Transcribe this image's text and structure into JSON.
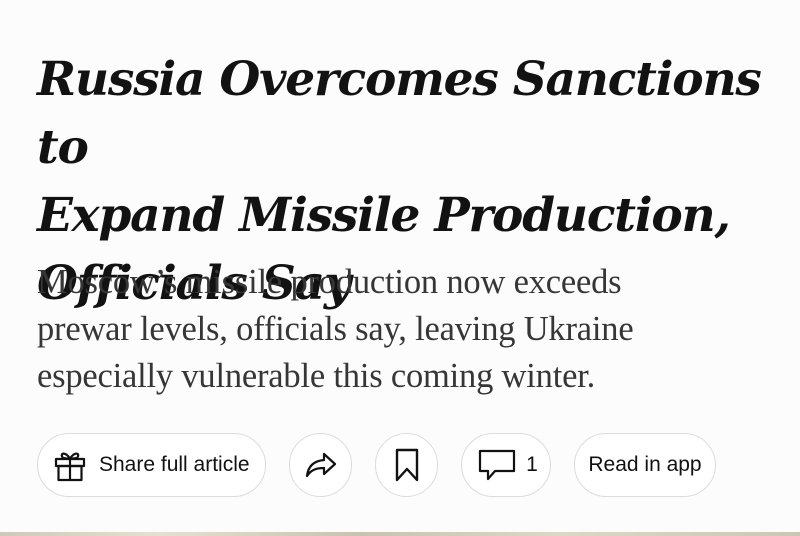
{
  "article": {
    "headline_lines": [
      "Russia Overcomes Sanctions to",
      "Expand Missile Production,",
      "Officials Say"
    ],
    "summary_lines": [
      "Moscow’s missile production now exceeds",
      "prewar levels, officials say, leaving Ukraine",
      "especially vulnerable this coming winter."
    ]
  },
  "toolbar": {
    "share_label": "Share full article",
    "comment_count": "1",
    "read_in_app_label": "Read in app",
    "icons": {
      "share": "gift-icon",
      "forward": "forward-arrow-icon",
      "save": "bookmark-icon",
      "comments": "comment-bubble-icon"
    }
  },
  "colors": {
    "headline": "#121212",
    "summary": "#363636",
    "pill_border": "#dcdcdc",
    "background": "#fcfcfc"
  }
}
